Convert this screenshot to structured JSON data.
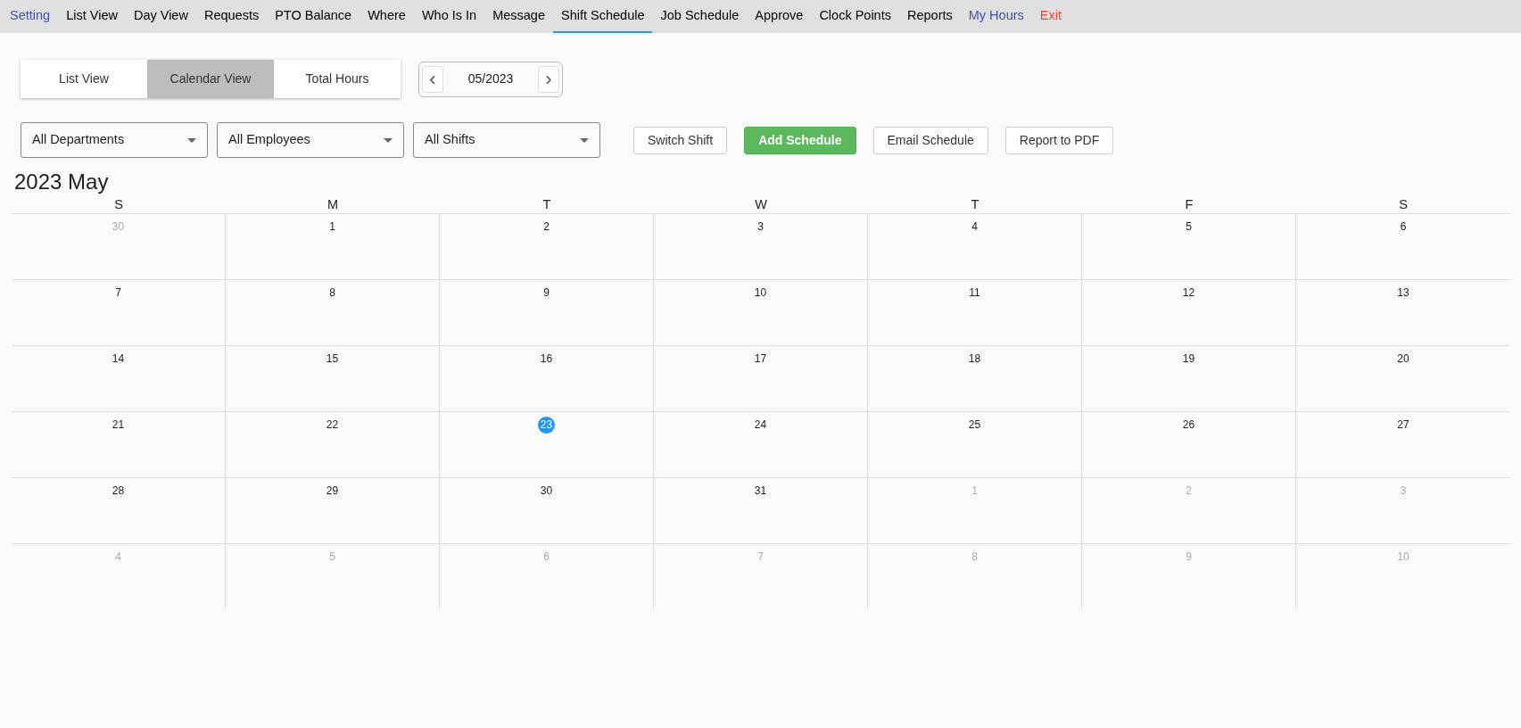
{
  "menu": [
    {
      "label": "Setting",
      "selected": false,
      "color": "#3f51b5"
    },
    {
      "label": "List View",
      "selected": false,
      "color": "#000000"
    },
    {
      "label": "Day View",
      "selected": false,
      "color": "#000000"
    },
    {
      "label": "Requests",
      "selected": false,
      "color": "#000000"
    },
    {
      "label": "PTO Balance",
      "selected": false,
      "color": "#000000"
    },
    {
      "label": "Where",
      "selected": false,
      "color": "#000000"
    },
    {
      "label": "Who Is In",
      "selected": false,
      "color": "#000000"
    },
    {
      "label": "Message",
      "selected": false,
      "color": "#000000"
    },
    {
      "label": "Shift Schedule",
      "selected": true,
      "color": "#000000"
    },
    {
      "label": "Job Schedule",
      "selected": false,
      "color": "#000000"
    },
    {
      "label": "Approve",
      "selected": false,
      "color": "#000000"
    },
    {
      "label": "Clock Points",
      "selected": false,
      "color": "#000000"
    },
    {
      "label": "Reports",
      "selected": false,
      "color": "#000000"
    },
    {
      "label": "My Hours",
      "selected": false,
      "color": "#3f51b5"
    },
    {
      "label": "Exit",
      "selected": false,
      "color": "#f44336"
    }
  ],
  "view_tabs": [
    {
      "label": "List View",
      "selected": false
    },
    {
      "label": "Calendar View",
      "selected": true
    },
    {
      "label": "Total Hours",
      "selected": false
    }
  ],
  "month_picker": {
    "prev": "‹",
    "value": "05/2023",
    "next": "›"
  },
  "filters": [
    {
      "value": "All Departments"
    },
    {
      "value": "All Employees"
    },
    {
      "value": "All Shifts"
    }
  ],
  "actions": [
    {
      "label": "Switch Shift",
      "kind": "outline"
    },
    {
      "label": "Add Schedule",
      "kind": "primary"
    },
    {
      "label": "Email Schedule",
      "kind": "outline"
    },
    {
      "label": "Report to PDF",
      "kind": "outline"
    }
  ],
  "calendar": {
    "title": "2023 May",
    "weekdays": [
      "S",
      "M",
      "T",
      "W",
      "T",
      "F",
      "S"
    ],
    "weeks": [
      [
        {
          "day": "30",
          "muted": true,
          "today": false
        },
        {
          "day": "1",
          "muted": false,
          "today": false
        },
        {
          "day": "2",
          "muted": false,
          "today": false
        },
        {
          "day": "3",
          "muted": false,
          "today": false
        },
        {
          "day": "4",
          "muted": false,
          "today": false
        },
        {
          "day": "5",
          "muted": false,
          "today": false
        },
        {
          "day": "6",
          "muted": false,
          "today": false
        }
      ],
      [
        {
          "day": "7",
          "muted": false,
          "today": false
        },
        {
          "day": "8",
          "muted": false,
          "today": false
        },
        {
          "day": "9",
          "muted": false,
          "today": false
        },
        {
          "day": "10",
          "muted": false,
          "today": false
        },
        {
          "day": "11",
          "muted": false,
          "today": false
        },
        {
          "day": "12",
          "muted": false,
          "today": false
        },
        {
          "day": "13",
          "muted": false,
          "today": false
        }
      ],
      [
        {
          "day": "14",
          "muted": false,
          "today": false
        },
        {
          "day": "15",
          "muted": false,
          "today": false
        },
        {
          "day": "16",
          "muted": false,
          "today": false
        },
        {
          "day": "17",
          "muted": false,
          "today": false
        },
        {
          "day": "18",
          "muted": false,
          "today": false
        },
        {
          "day": "19",
          "muted": false,
          "today": false
        },
        {
          "day": "20",
          "muted": false,
          "today": false
        }
      ],
      [
        {
          "day": "21",
          "muted": false,
          "today": false
        },
        {
          "day": "22",
          "muted": false,
          "today": false
        },
        {
          "day": "23",
          "muted": false,
          "today": true
        },
        {
          "day": "24",
          "muted": false,
          "today": false
        },
        {
          "day": "25",
          "muted": false,
          "today": false
        },
        {
          "day": "26",
          "muted": false,
          "today": false
        },
        {
          "day": "27",
          "muted": false,
          "today": false
        }
      ],
      [
        {
          "day": "28",
          "muted": false,
          "today": false
        },
        {
          "day": "29",
          "muted": false,
          "today": false
        },
        {
          "day": "30",
          "muted": false,
          "today": false
        },
        {
          "day": "31",
          "muted": false,
          "today": false
        },
        {
          "day": "1",
          "muted": true,
          "today": false
        },
        {
          "day": "2",
          "muted": true,
          "today": false
        },
        {
          "day": "3",
          "muted": true,
          "today": false
        }
      ],
      [
        {
          "day": "4",
          "muted": true,
          "today": false
        },
        {
          "day": "5",
          "muted": true,
          "today": false
        },
        {
          "day": "6",
          "muted": true,
          "today": false
        },
        {
          "day": "7",
          "muted": true,
          "today": false
        },
        {
          "day": "8",
          "muted": true,
          "today": false
        },
        {
          "day": "9",
          "muted": true,
          "today": false
        },
        {
          "day": "10",
          "muted": true,
          "today": false
        }
      ]
    ]
  }
}
